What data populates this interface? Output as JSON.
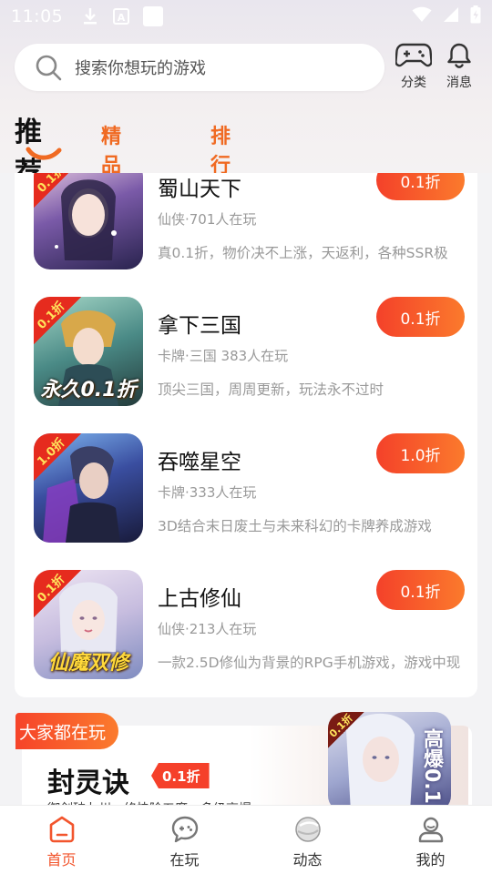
{
  "status_bar": {
    "time": "11:05"
  },
  "search": {
    "placeholder": "搜索你想玩的游戏"
  },
  "top_actions": [
    {
      "label": "分类",
      "icon": "gamepad-icon"
    },
    {
      "label": "消息",
      "icon": "bell-icon"
    }
  ],
  "tabs": [
    {
      "label": "推荐",
      "active": true
    },
    {
      "label": "精品新游",
      "active": false
    },
    {
      "label": "排行榜",
      "active": false
    }
  ],
  "games": [
    {
      "name": "蜀山天下",
      "meta": "仙侠·701人在玩",
      "desc": "真0.1折，物价决不上涨，天返利，各种SSR极",
      "discount": "0.1折",
      "corner": "0.1折",
      "overlay": ""
    },
    {
      "name": "拿下三国",
      "meta": "卡牌·三国  383人在玩",
      "desc": "顶尖三国，周周更新，玩法永不过时",
      "discount": "0.1折",
      "corner": "0.1折",
      "overlay": "永久0.1折"
    },
    {
      "name": "吞噬星空",
      "meta": "卡牌·333人在玩",
      "desc": "3D结合末日废土与未来科幻的卡牌养成游戏",
      "discount": "1.0折",
      "corner": "1.0折",
      "overlay": ""
    },
    {
      "name": "上古修仙",
      "meta": "仙侠·213人在玩",
      "desc": "一款2.5D修仙为背景的RPG手机游戏，游戏中现",
      "discount": "0.1折",
      "corner": "0.1折",
      "overlay": "仙魔双修"
    }
  ],
  "promo": {
    "tag": "大家都在玩",
    "title": "封灵诀",
    "badge": "0.1折",
    "subtitle": "御剑破九州，终快除五魔，多级高爆。",
    "art_corner": "0.1折",
    "art_text": "高爆0.1"
  },
  "bottom_nav": [
    {
      "label": "首页",
      "active": true
    },
    {
      "label": "在玩",
      "active": false
    },
    {
      "label": "动态",
      "active": false
    },
    {
      "label": "我的",
      "active": false
    }
  ],
  "colors": {
    "accent": "#f2552d",
    "tab_orange": "#f06a22",
    "badge_red": "#e62b1e"
  }
}
